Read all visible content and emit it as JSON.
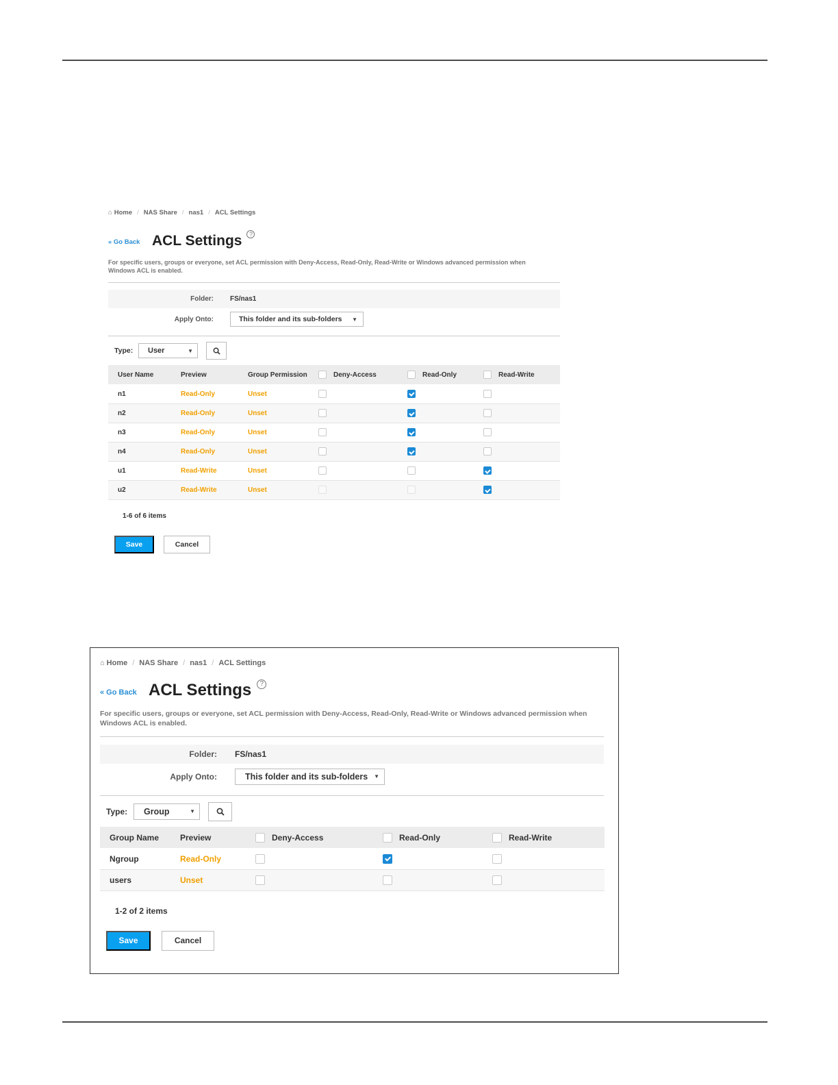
{
  "panel1": {
    "breadcrumb": [
      "Home",
      "NAS Share",
      "nas1",
      "ACL Settings"
    ],
    "go_back": "« Go Back",
    "title": "ACL Settings",
    "help_glyph": "?",
    "description": "For specific users, groups or everyone, set ACL permission with Deny-Access, Read-Only, Read-Write or Windows advanced permission when Windows ACL is enabled.",
    "folder_label": "Folder:",
    "folder_value": "FS/nas1",
    "apply_label": "Apply Onto:",
    "apply_value": "This folder and its sub-folders",
    "type_label": "Type:",
    "type_value": "User",
    "columns": {
      "name": "User Name",
      "preview": "Preview",
      "group_permission": "Group Permission",
      "deny": "Deny-Access",
      "read_only": "Read-Only",
      "read_write": "Read-Write"
    },
    "rows": [
      {
        "name": "n1",
        "preview": "Read-Only",
        "group": "Unset",
        "deny": false,
        "ro": true,
        "rw": false
      },
      {
        "name": "n2",
        "preview": "Read-Only",
        "group": "Unset",
        "deny": false,
        "ro": true,
        "rw": false
      },
      {
        "name": "n3",
        "preview": "Read-Only",
        "group": "Unset",
        "deny": false,
        "ro": true,
        "rw": false
      },
      {
        "name": "n4",
        "preview": "Read-Only",
        "group": "Unset",
        "deny": false,
        "ro": true,
        "rw": false
      },
      {
        "name": "u1",
        "preview": "Read-Write",
        "group": "Unset",
        "deny": false,
        "ro": false,
        "rw": true
      },
      {
        "name": "u2",
        "preview": "Read-Write",
        "group": "Unset",
        "deny": false,
        "ro": false,
        "rw": true
      }
    ],
    "items_count": "1-6 of 6 items",
    "save": "Save",
    "cancel": "Cancel"
  },
  "panel2": {
    "breadcrumb": [
      "Home",
      "NAS Share",
      "nas1",
      "ACL Settings"
    ],
    "go_back": "« Go Back",
    "title": "ACL Settings",
    "help_glyph": "?",
    "description": "For specific users, groups or everyone, set ACL permission with Deny-Access, Read-Only, Read-Write or Windows advanced permission when Windows ACL is enabled.",
    "folder_label": "Folder:",
    "folder_value": "FS/nas1",
    "apply_label": "Apply Onto:",
    "apply_value": "This folder and its sub-folders",
    "type_label": "Type:",
    "type_value": "Group",
    "columns": {
      "name": "Group Name",
      "preview": "Preview",
      "deny": "Deny-Access",
      "read_only": "Read-Only",
      "read_write": "Read-Write"
    },
    "rows": [
      {
        "name": "Ngroup",
        "preview": "Read-Only",
        "deny": false,
        "ro": true,
        "rw": false
      },
      {
        "name": "users",
        "preview": "Unset",
        "deny": false,
        "ro": false,
        "rw": false
      }
    ],
    "items_count": "1-2 of 2 items",
    "save": "Save",
    "cancel": "Cancel"
  },
  "colors": {
    "accent_blue": "#0aa0f0",
    "link_blue": "#2a8fd6",
    "preview_orange": "#f0a000"
  },
  "icons": {
    "home": "home-icon",
    "help": "help-circle-icon",
    "search": "search-icon",
    "caret": "caret-down-icon",
    "checkbox": "checkbox-icon"
  }
}
